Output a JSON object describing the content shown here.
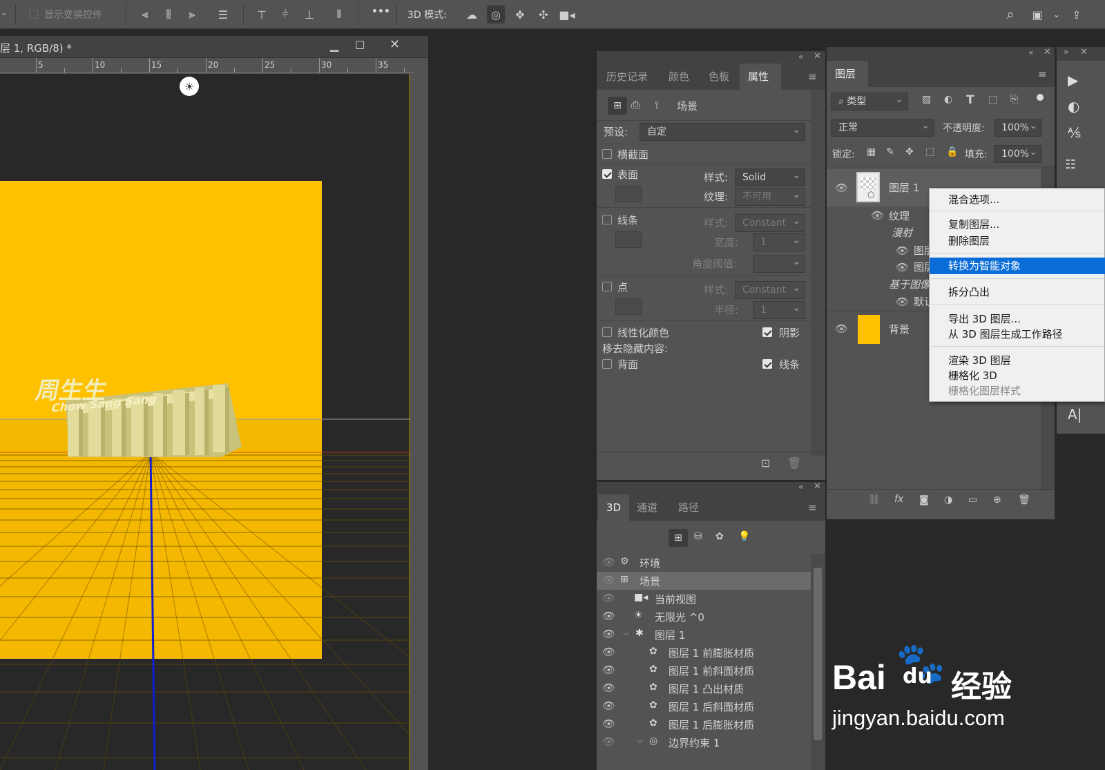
{
  "options_bar": {
    "show_transform_controls": "显示变换控件",
    "more": "•••",
    "mode_3d_label": "3D 模式:"
  },
  "document": {
    "title": "层 1, RGB/8) *",
    "ruler_ticks": [
      "5",
      "10",
      "15",
      "20",
      "25",
      "30",
      "35"
    ],
    "canvas_text": [
      "周生生",
      "Chow Sang Sang"
    ]
  },
  "properties_panel": {
    "tabs": [
      "历史记录",
      "颜色",
      "色板",
      "属性"
    ],
    "active_tab": "属性",
    "scene_label": "场景",
    "preset_label": "预设:",
    "preset_value": "自定",
    "cross_section": "横截面",
    "surface": "表面",
    "surface_style_label": "样式:",
    "surface_style_value": "Solid",
    "surface_texture_label": "纹理:",
    "surface_texture_value": "不可用",
    "lines": "线条",
    "lines_style_label": "样式:",
    "lines_style_value": "Constant",
    "lines_width_label": "宽度:",
    "lines_width_value": "1",
    "angle_threshold_label": "角度阈值:",
    "points": "点",
    "points_style_label": "样式:",
    "points_style_value": "Constant",
    "points_radius_label": "半径:",
    "points_radius_value": "1",
    "linearize_colors": "线性化颜色",
    "shadow": "阴影",
    "remove_hidden": "移去隐藏内容:",
    "backface": "背面",
    "lines2": "线条"
  },
  "panel_3d": {
    "tabs": [
      "3D",
      "通道",
      "路径"
    ],
    "active_tab": "3D",
    "rows": [
      {
        "label": "环境",
        "icon": "environment-icon"
      },
      {
        "label": "场景",
        "icon": "scene-icon"
      },
      {
        "label": "当前视图",
        "icon": "camera-icon"
      },
      {
        "label": "无限光 ^0",
        "icon": "light-icon"
      },
      {
        "label": "图层 1",
        "icon": "mesh-icon"
      },
      {
        "label": "图层 1 前膨胀材质",
        "icon": "material-icon"
      },
      {
        "label": "图层 1 前斜面材质",
        "icon": "material-icon"
      },
      {
        "label": "图层 1 凸出材质",
        "icon": "material-icon"
      },
      {
        "label": "图层 1 后斜面材质",
        "icon": "material-icon"
      },
      {
        "label": "图层 1 后膨胀材质",
        "icon": "material-icon"
      },
      {
        "label": "边界约束 1",
        "icon": "constraint-icon"
      }
    ]
  },
  "layers_panel": {
    "tab": "图层",
    "filter_kind": "类型",
    "blend_mode": "正常",
    "opacity_label": "不透明度:",
    "opacity_value": "100%",
    "lock_label": "锁定:",
    "fill_label": "填充:",
    "fill_value": "100%",
    "layer1_name": "图层 1",
    "texture_label": "纹理",
    "diffuse_label": "漫射",
    "sub1": "图层",
    "sub2": "图层",
    "image_based": "基于图像",
    "default_label": "默认",
    "background_name": "背景",
    "accent_yellow": "#FFC000"
  },
  "context_menu": {
    "items": [
      {
        "label": "混合选项...",
        "state": "normal"
      },
      {
        "label": "复制图层...",
        "state": "normal"
      },
      {
        "label": "删除图层",
        "state": "normal"
      },
      {
        "label": "转换为智能对象",
        "state": "highlighted"
      },
      {
        "label": "拆分凸出",
        "state": "normal"
      },
      {
        "label": "导出 3D 图层...",
        "state": "normal"
      },
      {
        "label": "从 3D 图层生成工作路径",
        "state": "normal"
      },
      {
        "label": "渲染 3D 图层",
        "state": "normal"
      },
      {
        "label": "栅格化 3D",
        "state": "normal"
      },
      {
        "label": "栅格化图层样式",
        "state": "disabled"
      }
    ]
  },
  "watermark": {
    "brand": "Bai",
    "du": "du",
    "jingyan": "经验",
    "url": "jingyan.baidu.com"
  },
  "colors": {
    "canvas_yellow": "#FFC000",
    "highlight_blue": "#0A6CD6",
    "ui_panel": "#535353"
  }
}
